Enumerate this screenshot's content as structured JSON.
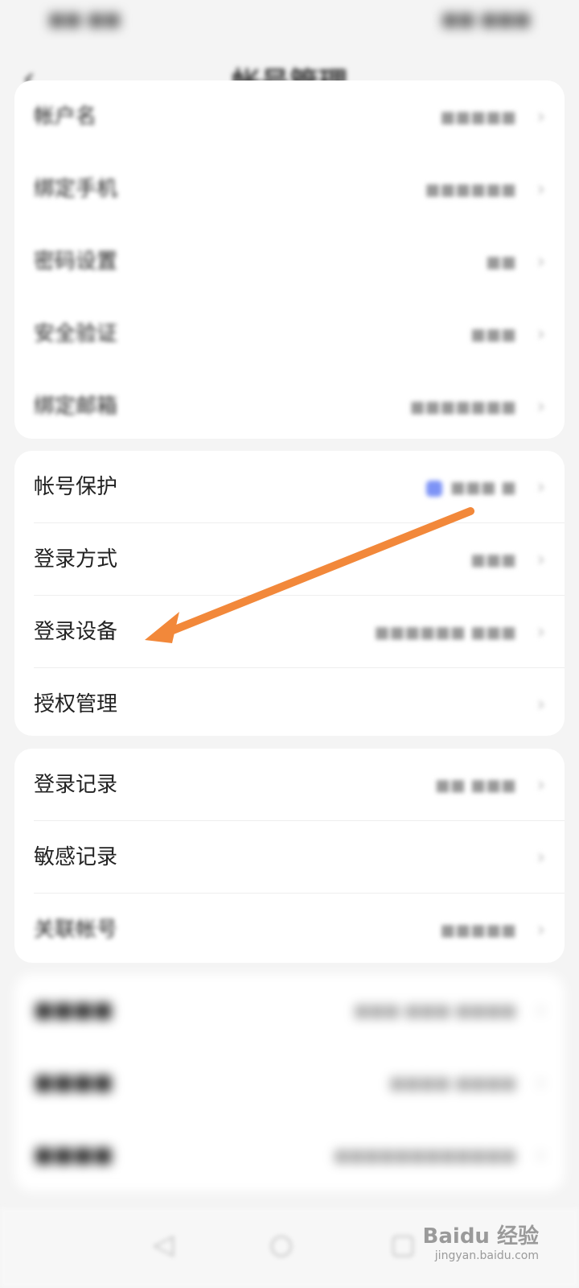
{
  "status_bar": {
    "left": "■■ ■■",
    "right": "■■ ■■■"
  },
  "header": {
    "back_icon": "‹",
    "title": "帐号管理"
  },
  "card1": [
    {
      "label": "帐户名",
      "value": "■■■■■"
    },
    {
      "label": "绑定手机",
      "value": "■■■■■■"
    },
    {
      "label": "密码设置",
      "value": "■■"
    },
    {
      "label": "安全验证",
      "value": "■■■"
    },
    {
      "label": "绑定邮箱",
      "value": "■■■■■■■"
    }
  ],
  "card2": [
    {
      "label": "帐号保护",
      "value": "■■■ ■"
    },
    {
      "label": "登录方式",
      "value": "■■■"
    },
    {
      "label": "登录设备",
      "value": "■■■■■■ ■■■"
    },
    {
      "label": "授权管理",
      "value": ""
    }
  ],
  "card3": [
    {
      "label": "登录记录",
      "value": "■■ ■■■"
    },
    {
      "label": "敏感记录",
      "value": ""
    },
    {
      "label": "关联帐号",
      "value": "■■■■■"
    }
  ],
  "card4": [
    {
      "label": "■■■■",
      "value": "■■■ ■■■ ■■■■"
    },
    {
      "label": "■■■■",
      "value": "■■■■ ■■■■"
    },
    {
      "label": "■■■■",
      "value": "■■■■■■■■■■■■"
    }
  ],
  "nav": {
    "back": "◁",
    "home": "○",
    "recent": "▢"
  },
  "watermark": {
    "brand": "Baidu 经验",
    "url": "jingyan.baidu.com"
  },
  "accent_color": "#f2883a"
}
